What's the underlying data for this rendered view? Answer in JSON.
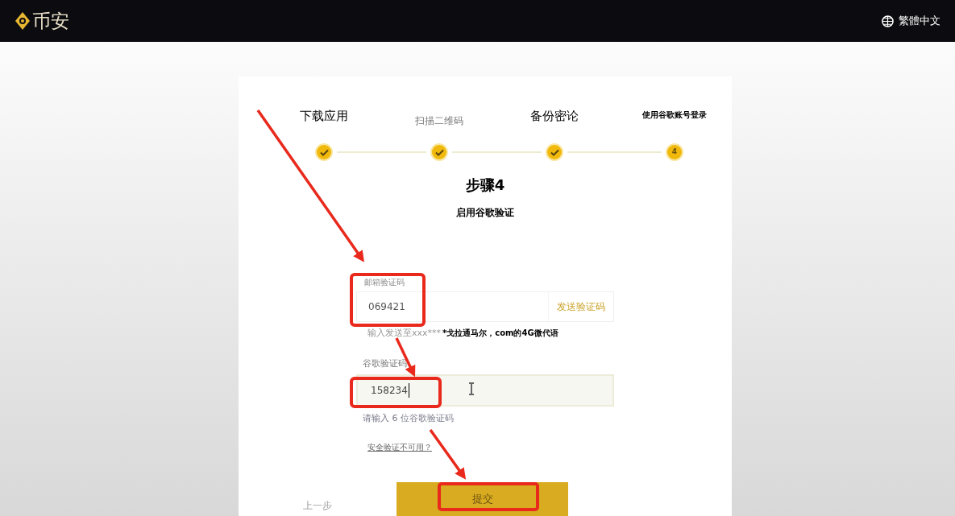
{
  "header": {
    "logo_text": "币安",
    "language": "繁體中文"
  },
  "steps": [
    {
      "label": "下载应用",
      "done": true
    },
    {
      "label": "扫描二维码",
      "done": true
    },
    {
      "label": "备份密论",
      "done": true
    },
    {
      "label": "使用谷歌账号登录",
      "done": false,
      "number": "4"
    }
  ],
  "title": "步骤4",
  "subtitle": "启用谷歌验证",
  "email_code": {
    "label": "邮箱验证码",
    "value": "069421",
    "send_button": "发送验证码",
    "hint": "输入发送至xxx***",
    "note": "*戈拉通马尔，com的4G微代语"
  },
  "google_code": {
    "label": "谷歌验证码",
    "value": "158234",
    "hint": "请输入 6 位谷歌验证码"
  },
  "link": "安全验证不可用？",
  "back": "上一步",
  "submit": "提交"
}
